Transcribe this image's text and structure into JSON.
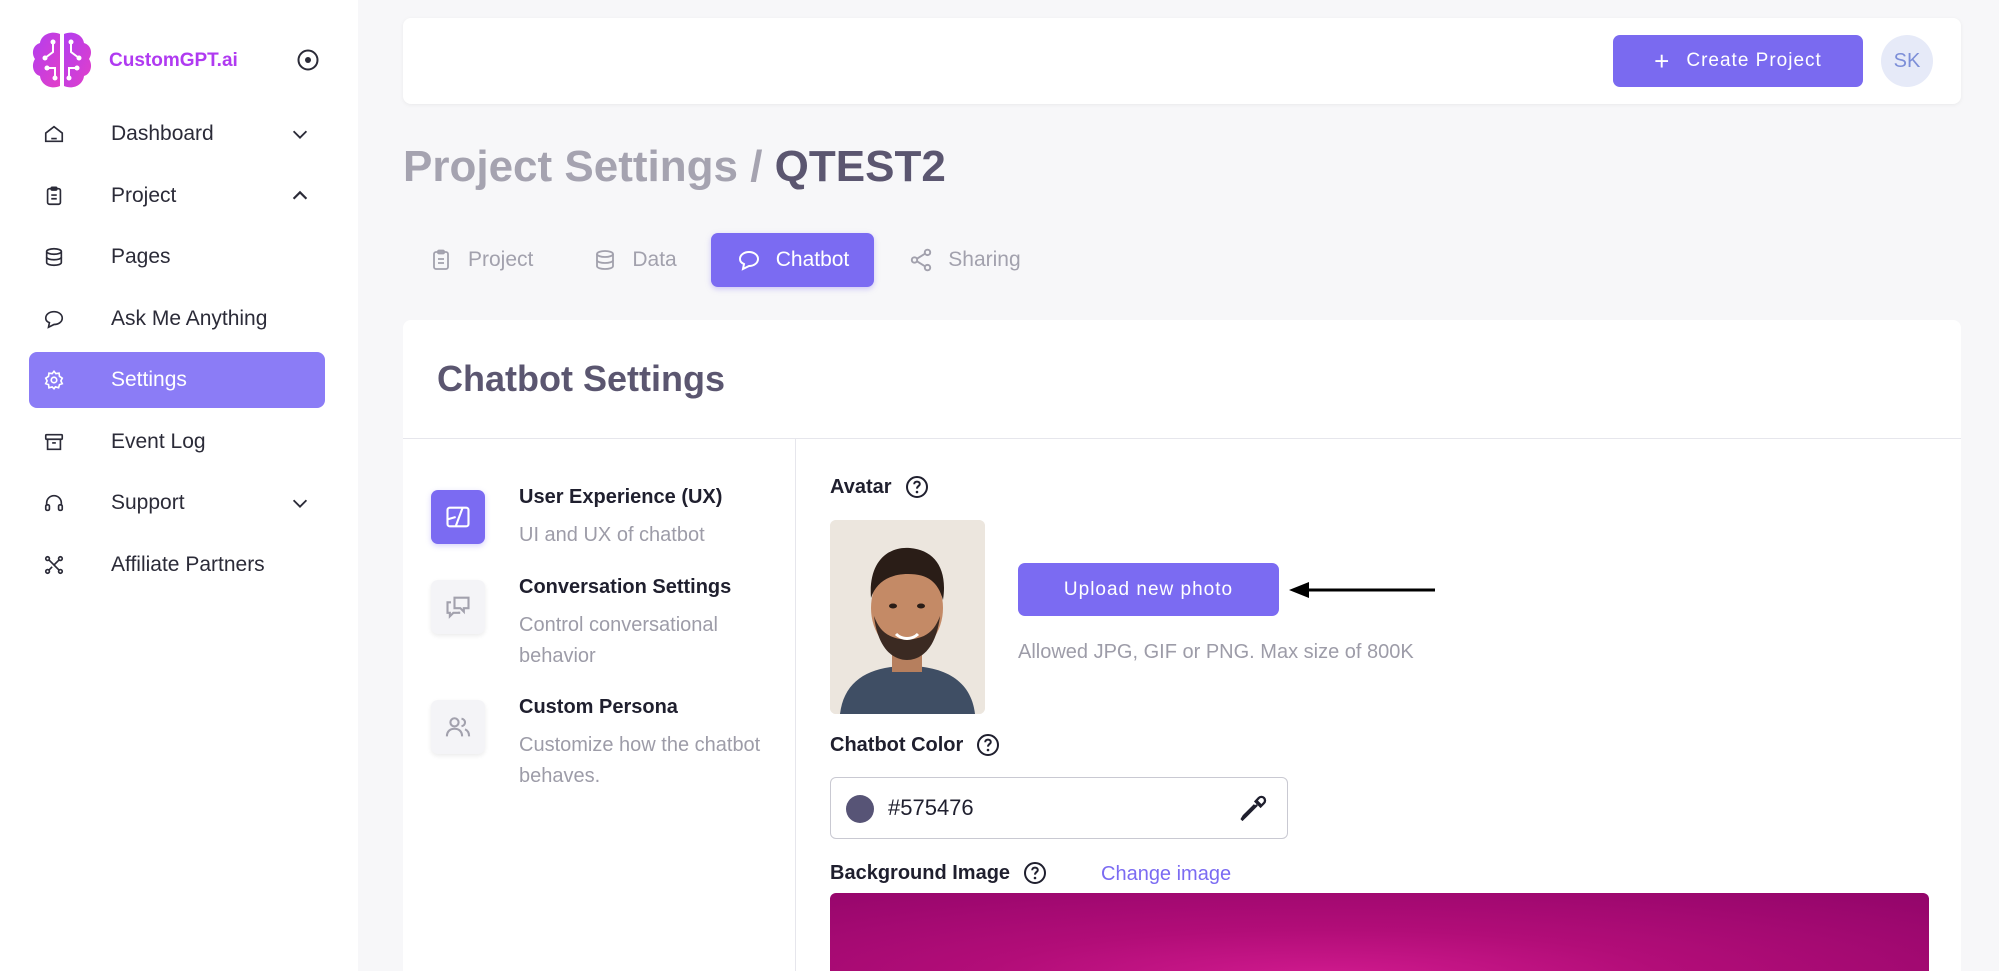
{
  "brand": {
    "name": "CustomGPT.ai",
    "color": "#b03af1"
  },
  "sidebar": {
    "items": [
      {
        "label": "Dashboard",
        "icon": "home-icon",
        "chevron": "down"
      },
      {
        "label": "Project",
        "icon": "clipboard-icon",
        "chevron": "up"
      },
      {
        "label": "Pages",
        "icon": "database-icon"
      },
      {
        "label": "Ask Me Anything",
        "icon": "chat-icon"
      },
      {
        "label": "Settings",
        "icon": "gear-icon",
        "active": true
      },
      {
        "label": "Event Log",
        "icon": "archive-icon"
      },
      {
        "label": "Support",
        "icon": "headset-icon",
        "chevron": "down"
      },
      {
        "label": "Affiliate Partners",
        "icon": "network-icon"
      }
    ]
  },
  "topbar": {
    "create_label": "Create Project",
    "user_initials": "SK"
  },
  "heading": {
    "prefix": "Project Settings / ",
    "project_name": "QTEST2"
  },
  "tabs": [
    {
      "label": "Project",
      "icon": "clipboard-icon"
    },
    {
      "label": "Data",
      "icon": "database-icon"
    },
    {
      "label": "Chatbot",
      "icon": "chat-icon",
      "active": true
    },
    {
      "label": "Sharing",
      "icon": "share-icon"
    }
  ],
  "card": {
    "title": "Chatbot Settings",
    "menu": [
      {
        "title": "User Experience (UX)",
        "desc": "UI and UX of chatbot",
        "active": true
      },
      {
        "title": "Conversation Settings",
        "desc": "Control conversational behavior"
      },
      {
        "title": "Custom Persona",
        "desc": "Customize how the chatbot behaves."
      }
    ],
    "avatar": {
      "label": "Avatar",
      "upload_label": "Upload new photo",
      "allowed_text": "Allowed JPG, GIF or PNG. Max size of 800K"
    },
    "chatbot_color": {
      "label": "Chatbot Color",
      "value": "#575476"
    },
    "background_image": {
      "label": "Background Image",
      "change_label": "Change image"
    }
  },
  "colors": {
    "accent": "#7b6bf2",
    "sidebar_active": "#8b7cf6"
  }
}
